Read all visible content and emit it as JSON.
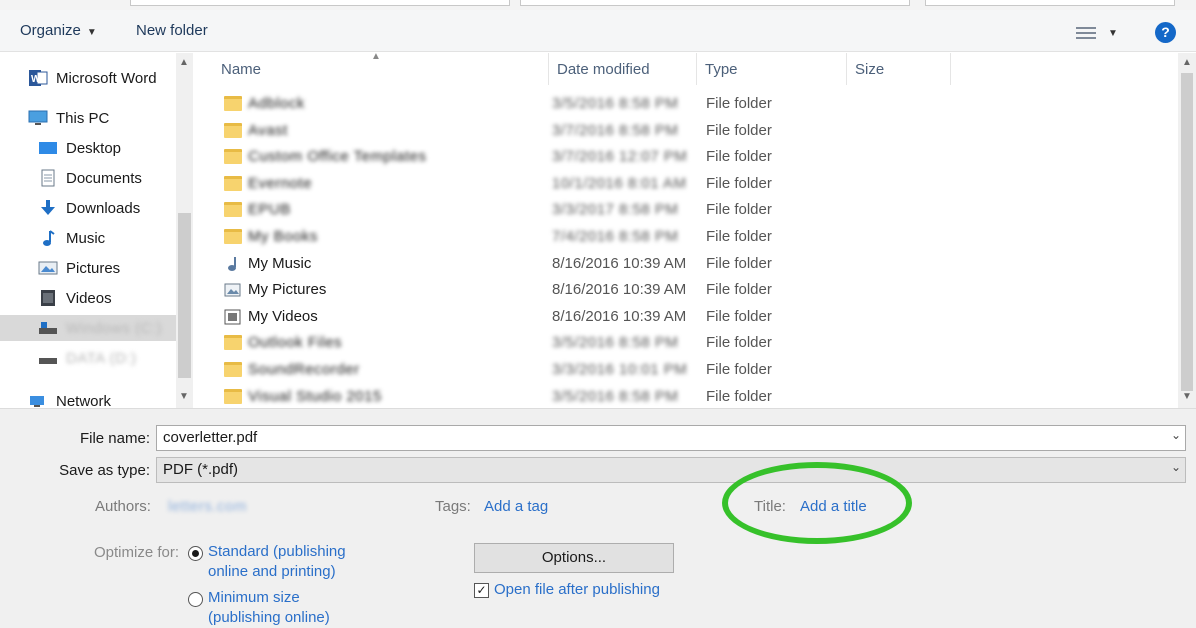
{
  "toolbar": {
    "organize_label": "Organize",
    "new_folder_label": "New folder",
    "help_glyph": "?"
  },
  "nav": {
    "items": [
      {
        "label": "Microsoft Word",
        "icon": "word-icon"
      },
      {
        "label": "This PC",
        "icon": "pc-icon"
      },
      {
        "label": "Desktop",
        "icon": "desktop-icon"
      },
      {
        "label": "Documents",
        "icon": "documents-icon"
      },
      {
        "label": "Downloads",
        "icon": "downloads-icon"
      },
      {
        "label": "Music",
        "icon": "music-icon"
      },
      {
        "label": "Pictures",
        "icon": "pictures-icon"
      },
      {
        "label": "Videos",
        "icon": "videos-icon"
      },
      {
        "label": "Windows (C:)",
        "icon": "drive-icon",
        "blurred": true
      },
      {
        "label": "DATA (D:)",
        "icon": "drive-icon",
        "blurred": true
      },
      {
        "label": "Network",
        "icon": "network-icon"
      }
    ]
  },
  "list": {
    "columns": {
      "name": "Name",
      "date": "Date modified",
      "type": "Type",
      "size": "Size"
    },
    "rows": [
      {
        "name": "Adblock",
        "date": "3/5/2016 8:58 PM",
        "type": "File folder",
        "blurred": true,
        "icon": "folder-icon"
      },
      {
        "name": "Avast",
        "date": "3/7/2016 8:58 PM",
        "type": "File folder",
        "blurred": true,
        "icon": "folder-icon"
      },
      {
        "name": "Custom Office Templates",
        "date": "3/7/2016 12:07 PM",
        "type": "File folder",
        "blurred": true,
        "icon": "folder-icon"
      },
      {
        "name": "Evernote",
        "date": "10/1/2016 8:01 AM",
        "type": "File folder",
        "blurred": true,
        "icon": "folder-icon"
      },
      {
        "name": "EPUB",
        "date": "3/3/2017 8:58 PM",
        "type": "File folder",
        "blurred": true,
        "icon": "folder-icon"
      },
      {
        "name": "My Books",
        "date": "7/4/2016 8:58 PM",
        "type": "File folder",
        "blurred": true,
        "icon": "folder-icon"
      },
      {
        "name": "My Music",
        "date": "8/16/2016 10:39 AM",
        "type": "File folder",
        "blurred": false,
        "icon": "music-folder-icon"
      },
      {
        "name": "My Pictures",
        "date": "8/16/2016 10:39 AM",
        "type": "File folder",
        "blurred": false,
        "icon": "pictures-folder-icon"
      },
      {
        "name": "My Videos",
        "date": "8/16/2016 10:39 AM",
        "type": "File folder",
        "blurred": false,
        "icon": "videos-folder-icon"
      },
      {
        "name": "Outlook Files",
        "date": "3/5/2016 8:58 PM",
        "type": "File folder",
        "blurred": true,
        "icon": "folder-icon"
      },
      {
        "name": "SoundRecorder",
        "date": "3/3/2016 10:01 PM",
        "type": "File folder",
        "blurred": true,
        "icon": "folder-icon"
      },
      {
        "name": "Visual Studio 2015",
        "date": "3/5/2016 8:58 PM",
        "type": "File folder",
        "blurred": true,
        "icon": "folder-icon"
      }
    ]
  },
  "save": {
    "filename_label": "File name:",
    "filename_value": "coverletter.pdf",
    "type_label": "Save as type:",
    "type_value": "PDF (*.pdf)"
  },
  "meta": {
    "authors_label": "Authors:",
    "authors_value": "letters.com",
    "tags_label": "Tags:",
    "tags_value": "Add a tag",
    "title_label": "Title:",
    "title_value": "Add a title",
    "highlight_color": "#36c12a"
  },
  "optimize": {
    "label": "Optimize for:",
    "standard_line1": "Standard (publishing",
    "standard_line2": "online and printing)",
    "minimum_line1": "Minimum size",
    "minimum_line2": "(publishing online)"
  },
  "options": {
    "button_label": "Options...",
    "open_after_label": "Open file after publishing"
  }
}
